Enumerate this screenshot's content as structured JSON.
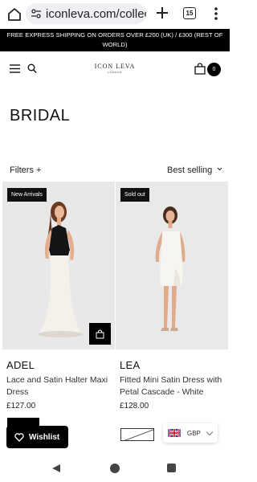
{
  "browser": {
    "url": "iconleva.com/collec",
    "tab_count": "15"
  },
  "announcement": "FREE EXPRESS SHIPPING ON ORDERS OVER £200 (UK) / £300 (REST OF WORLD)",
  "header": {
    "logo_main": "ICON LEVA",
    "logo_sub": "LONDON",
    "cart_count": "0"
  },
  "page": {
    "title": "BRIDAL",
    "filters_label": "Filters +",
    "sort_label": "Best selling"
  },
  "products": [
    {
      "badge": "New Arrivals",
      "name": "ADEL",
      "description": "Lace and Satin Halter Maxi Dress",
      "price": "£127.00"
    },
    {
      "badge": "Sold out",
      "name": "LEA",
      "description": "Fitted Mini Satin Dress with Petal Cascade - White",
      "price": "£128.00"
    }
  ],
  "widgets": {
    "wishlist_label": "Wishlist",
    "currency": "GBP"
  },
  "icons": [
    "home-icon",
    "tune-icon",
    "plus-icon",
    "tabs-icon",
    "kebab-icon",
    "menu-icon",
    "search-icon",
    "bag-icon",
    "chevron-down-icon",
    "heart-icon",
    "uk-flag-icon",
    "back-icon",
    "home-circle-icon",
    "recents-icon"
  ],
  "colors": {
    "announcement_bg": "#000000",
    "badge_bg": "#111111",
    "image_bg": "#e9e9e9"
  }
}
